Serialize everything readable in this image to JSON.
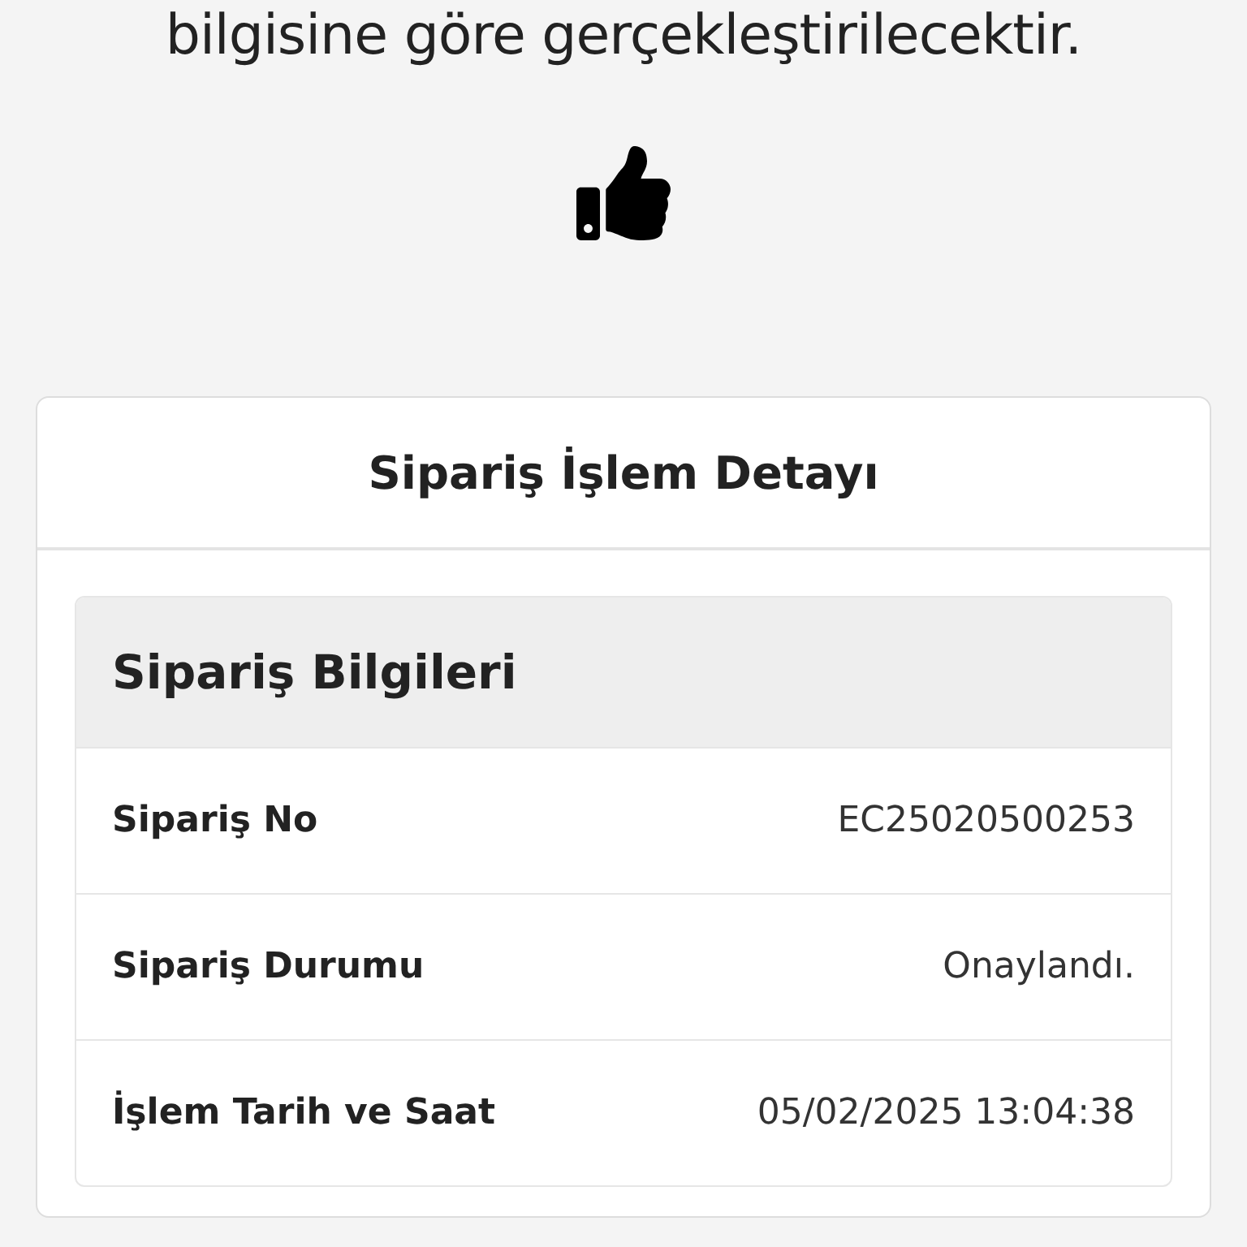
{
  "message": "bilgisine göre gerçekleştirilecektir.",
  "card": {
    "title": "Sipariş İşlem Detayı",
    "section": {
      "title": "Sipariş Bilgileri",
      "rows": [
        {
          "label": "Sipariş No",
          "value": "EC25020500253"
        },
        {
          "label": "Sipariş Durumu",
          "value": "Onaylandı."
        },
        {
          "label": "İşlem Tarih ve Saat",
          "value": "05/02/2025 13:04:38"
        }
      ]
    }
  }
}
